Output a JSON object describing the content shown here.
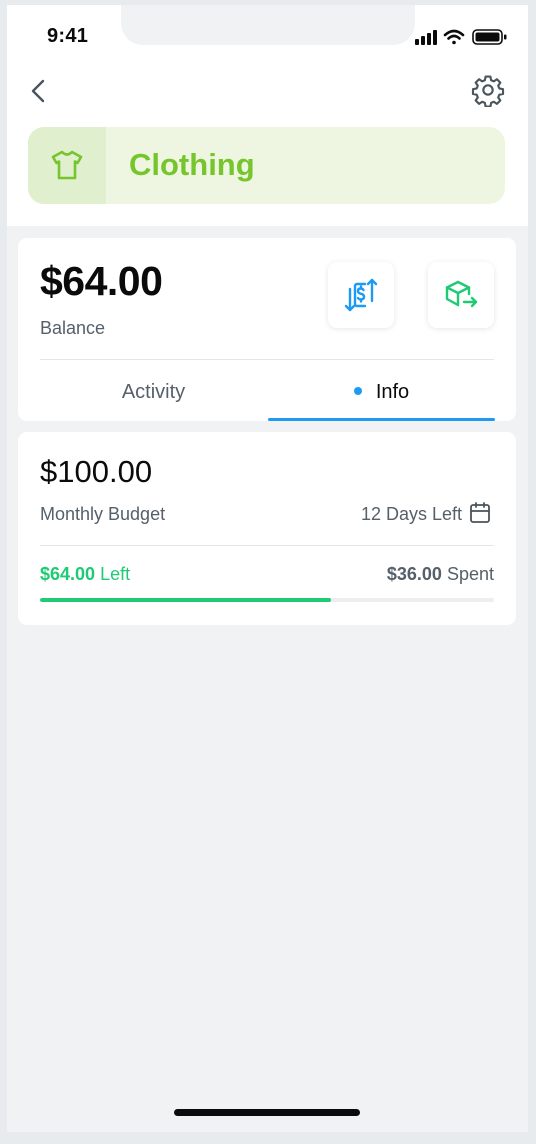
{
  "status_bar": {
    "time": "9:41"
  },
  "category": {
    "name": "Clothing",
    "icon": "tshirt-icon",
    "accent": "#76c52c"
  },
  "balance": {
    "amount": "$64.00",
    "label": "Balance",
    "actions": [
      {
        "name": "transfer-money",
        "icon": "dollar-transfer-icon"
      },
      {
        "name": "move-envelope",
        "icon": "box-arrow-icon"
      }
    ]
  },
  "tabs": [
    {
      "label": "Activity",
      "active": false
    },
    {
      "label": "Info",
      "active": true
    }
  ],
  "budget": {
    "amount": "$100.00",
    "label": "Monthly Budget",
    "days_left": "12 Days Left",
    "left_amount": "$64.00",
    "left_label": "Left",
    "spent_amount": "$36.00",
    "spent_label": "Spent",
    "spent_fraction": 0.64
  },
  "colors": {
    "primary_blue": "#1e9bf0",
    "success_green": "#1ecb74",
    "category_green": "#76c52c"
  }
}
